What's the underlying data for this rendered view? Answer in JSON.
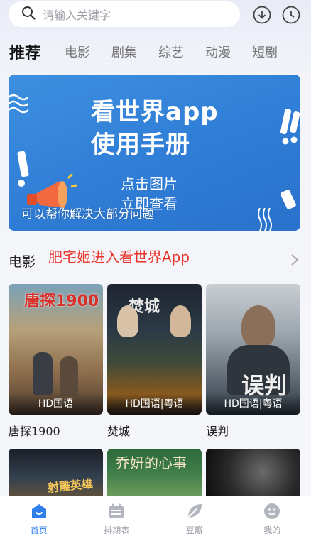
{
  "search": {
    "placeholder": "请输入关键字"
  },
  "tabs": [
    {
      "label": "推荐",
      "active": true
    },
    {
      "label": "电影"
    },
    {
      "label": "剧集"
    },
    {
      "label": "综艺"
    },
    {
      "label": "动漫"
    },
    {
      "label": "短剧"
    }
  ],
  "banner": {
    "title_line1": "看世界app",
    "title_line2": "使用手册",
    "sub_line1": "点击图片",
    "sub_line2": "立即查看",
    "caption": "可以帮你解决大部分问题"
  },
  "section": {
    "title": "电影",
    "promo": "肥宅姬进入看世界App"
  },
  "movies": [
    {
      "name": "唐探1900",
      "badge": "HD国语",
      "poster_text": "唐探1900"
    },
    {
      "name": "焚城",
      "badge": "HD国语|粤语",
      "poster_text": "焚城"
    },
    {
      "name": "误判",
      "badge": "HD国语|粤语",
      "poster_text": "误判"
    }
  ],
  "row2_posters": [
    {
      "poster_text": "射雕英雄传"
    },
    {
      "poster_text": "乔妍的心事"
    },
    {
      "poster_text": ""
    }
  ],
  "bottom_nav": [
    {
      "label": "首页",
      "icon": "home-icon",
      "active": true
    },
    {
      "label": "排期表",
      "icon": "calendar-icon"
    },
    {
      "label": "豆瓣",
      "icon": "leaf-icon"
    },
    {
      "label": "我的",
      "icon": "user-face-icon"
    }
  ],
  "colors": {
    "accent": "#2f80ed",
    "promo": "#e8342a",
    "banner": "#3385dd"
  }
}
